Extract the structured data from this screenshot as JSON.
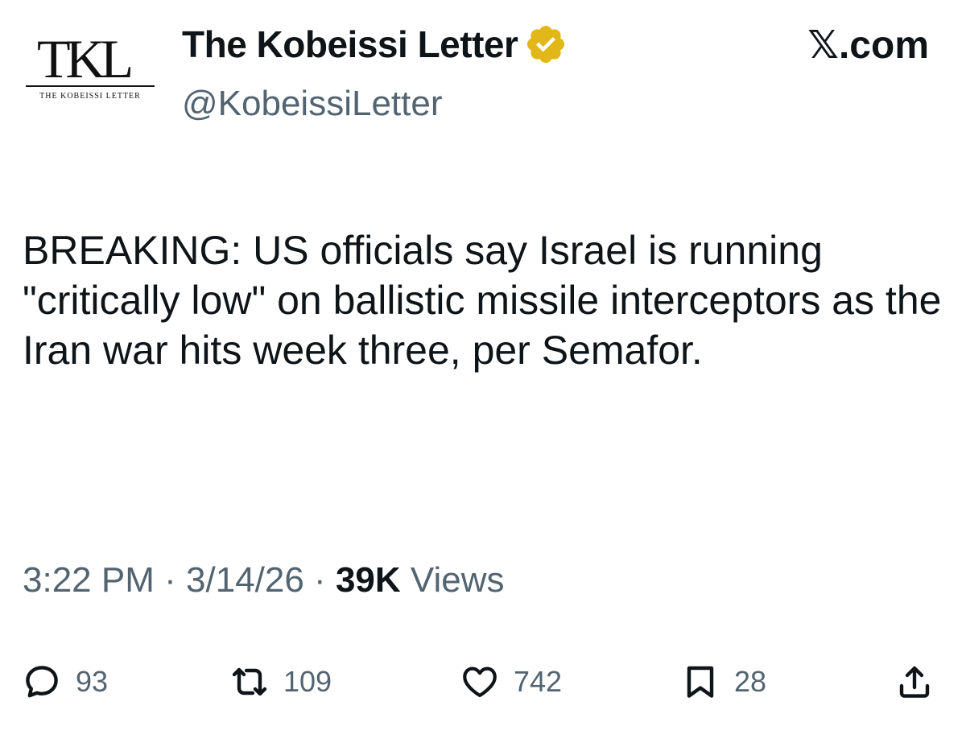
{
  "header": {
    "logo": {
      "mark": "TKL",
      "subtitle": "THE KOBEISSI LETTER"
    },
    "display_name": "The Kobeissi Letter",
    "verified_badge": "gold-verified-check-icon",
    "handle": "@KobeissiLetter",
    "brand": "𝕏.com"
  },
  "tweet": {
    "text": "BREAKING: US officials say Israel is running \"critically low\" on ballistic missile interceptors as the Iran war hits week three, per Semafor."
  },
  "meta": {
    "time": "3:22 PM",
    "separator": "·",
    "date": "3/14/26",
    "views_count": "39K",
    "views_label": "Views"
  },
  "actions": {
    "reply": {
      "icon": "reply-bubble-icon",
      "count": "93"
    },
    "repost": {
      "icon": "repost-arrows-icon",
      "count": "109"
    },
    "like": {
      "icon": "heart-icon",
      "count": "742"
    },
    "bookmark": {
      "icon": "bookmark-icon",
      "count": "28"
    },
    "share": {
      "icon": "share-upload-icon"
    }
  },
  "colors": {
    "text_primary": "#0f1419",
    "text_secondary": "#536471",
    "verified_gold": "#e2b719",
    "background": "#ffffff"
  }
}
